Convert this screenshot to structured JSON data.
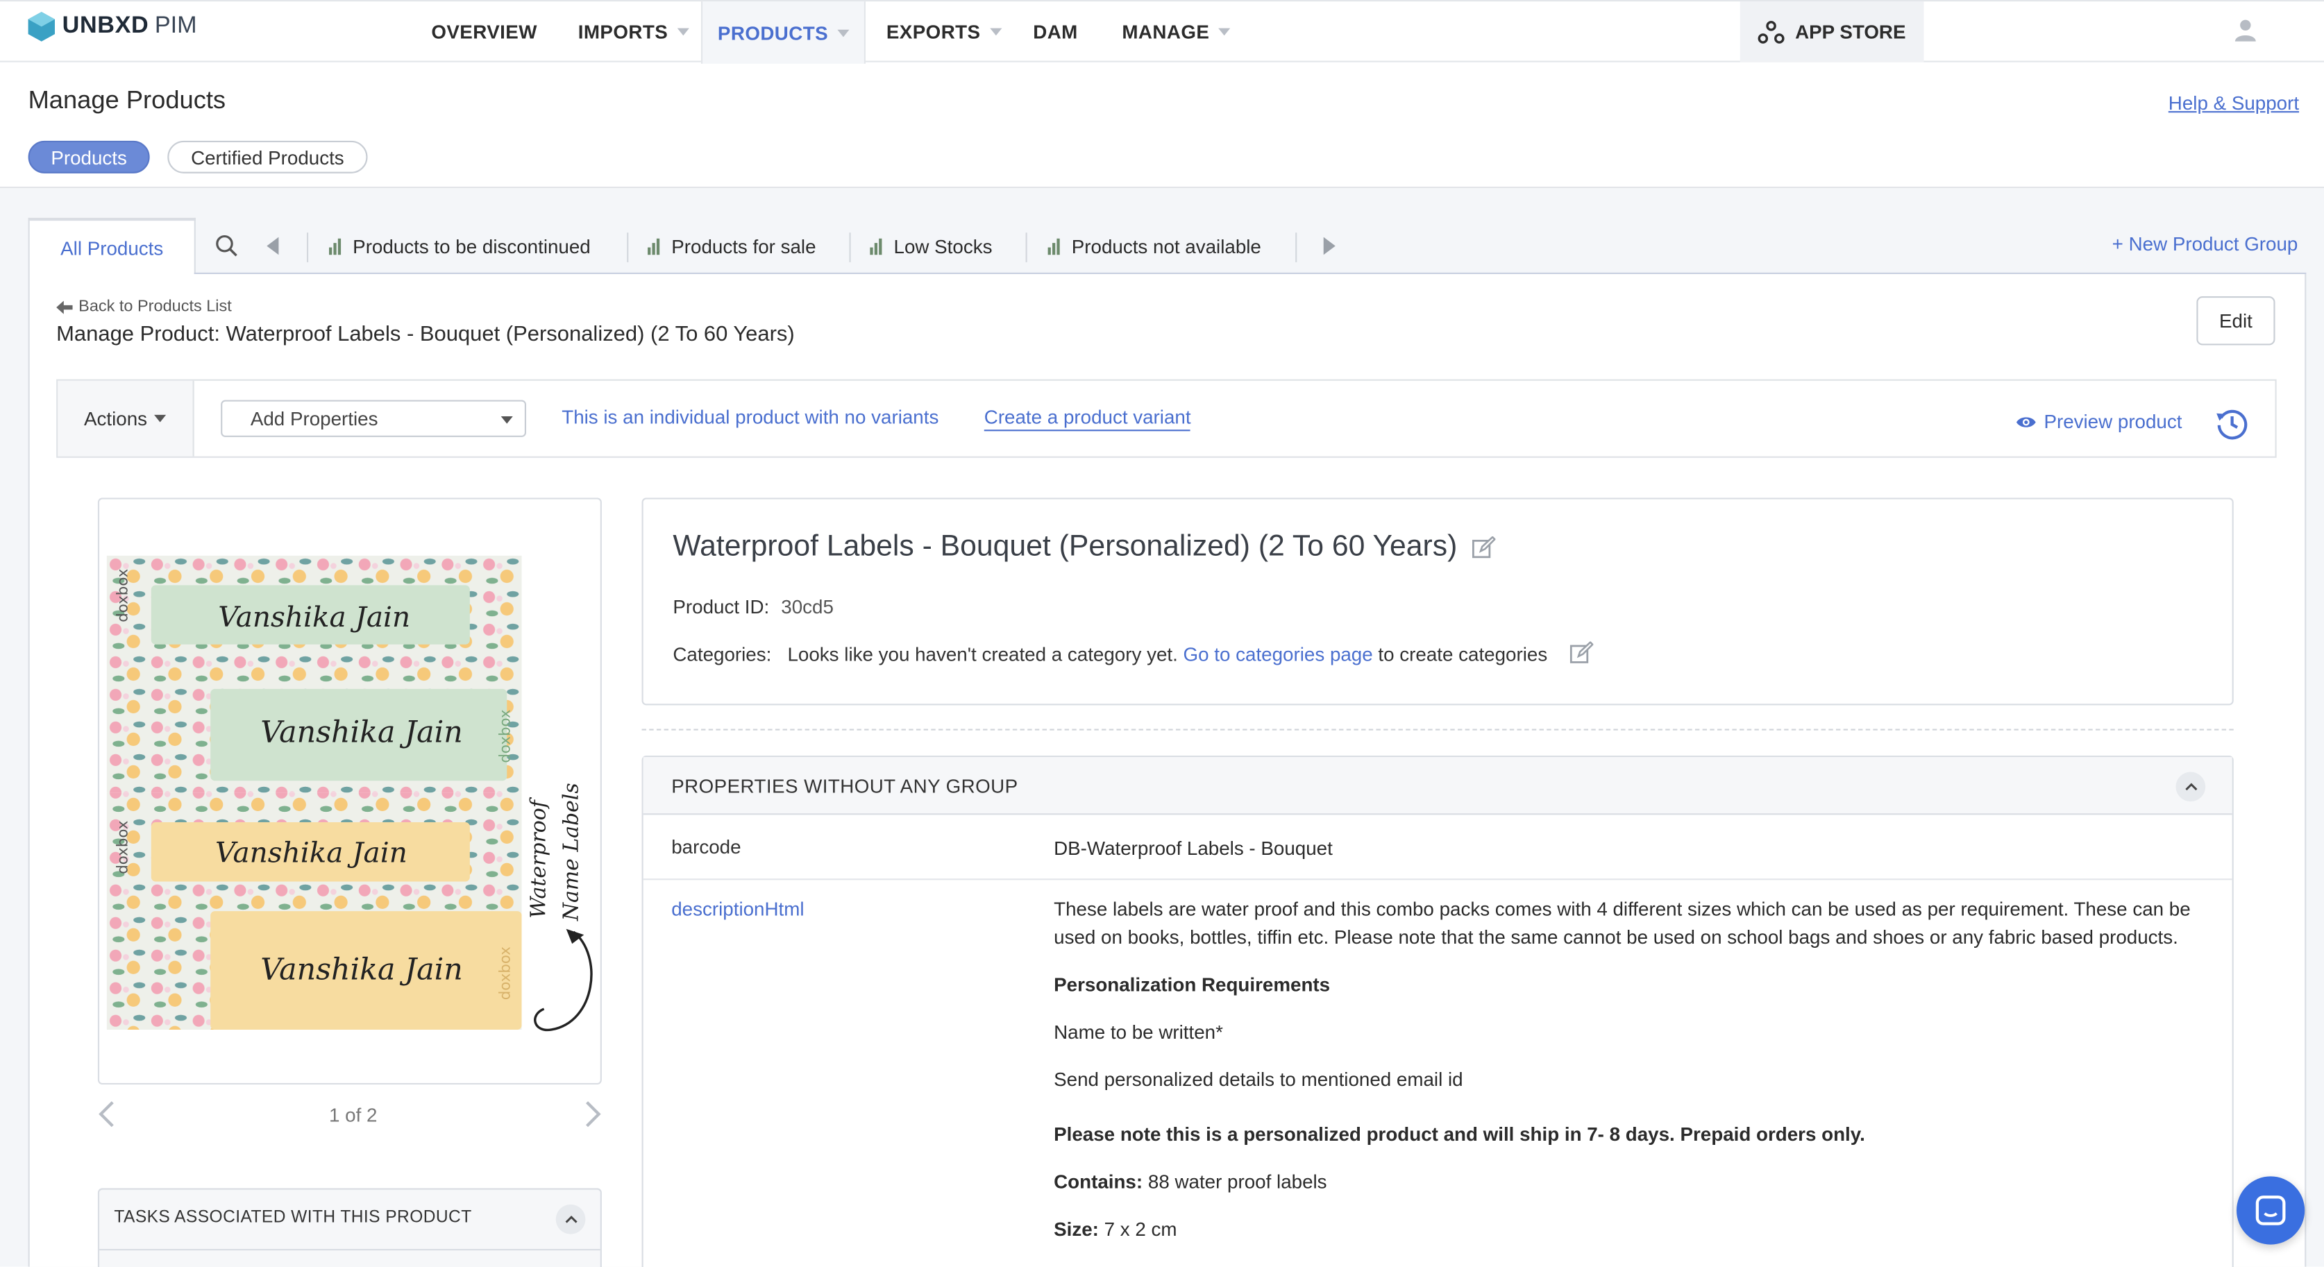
{
  "app": {
    "brand": "UNBXD",
    "product": "PIM"
  },
  "nav": {
    "overview": "OVERVIEW",
    "imports": "IMPORTS",
    "products": "PRODUCTS",
    "exports": "EXPORTS",
    "dam": "DAM",
    "manage": "MANAGE",
    "app_store": "APP STORE"
  },
  "page": {
    "title": "Manage Products",
    "help_link": "Help & Support",
    "pills": {
      "products": "Products",
      "certified": "Certified Products"
    }
  },
  "groups": {
    "all": "All Products",
    "items": [
      "Products to be discontinued",
      "Products for sale",
      "Low Stocks",
      "Products not available"
    ],
    "new_group": "+ New Product Group"
  },
  "detail": {
    "back": "Back to Products List",
    "title": "Manage Product: Waterproof Labels - Bouquet (Personalized) (2 To 60 Years)",
    "edit": "Edit",
    "actions": "Actions",
    "add_properties": "Add Properties",
    "individual_note": "This is an individual product with no variants",
    "create_variant": "Create a product variant",
    "preview": "Preview product"
  },
  "image": {
    "counter": "1 of 2",
    "label_names": [
      "Vanshika Jain",
      "Vanshika Jain",
      "Vanshika Jain",
      "Vanshika Jain"
    ],
    "brand_mark": "doxbox",
    "side_text_1": "Waterproof",
    "side_text_2": "Name Labels"
  },
  "tasks": {
    "title": "TASKS ASSOCIATED WITH THIS PRODUCT"
  },
  "product": {
    "name": "Waterproof Labels - Bouquet (Personalized) (2 To 60 Years)",
    "id_label": "Product ID:",
    "id_value": "30cd5",
    "categories_label": "Categories:",
    "categories_text": "Looks like you haven't created a category yet.",
    "categories_link": "Go to categories page",
    "categories_suffix": "to create categories"
  },
  "properties": {
    "title": "PROPERTIES WITHOUT ANY GROUP",
    "barcode_key": "barcode",
    "barcode_val": "DB-Waterproof Labels - Bouquet",
    "desc_key": "descriptionHtml",
    "desc_p1": "These labels are water proof and this combo packs comes with 4 different sizes which can be used as per requirement. These can be used on books, bottles, tiffin etc. Please note that the same cannot be used on school bags and shoes or any fabric based products.",
    "desc_h": "Personalization Requirements",
    "desc_p2": "Name to be written*",
    "desc_p3": "Send personalized details to mentioned email id",
    "desc_note": "Please note this is a personalized product and will ship in 7- 8 days. Prepaid orders only.",
    "contains_label": "Contains:",
    "contains_val": "88 water proof labels",
    "size_label": "Size:",
    "size_val": "7 x 2 cm"
  },
  "colors": {
    "accent": "#4a6fcf",
    "pill_active": "#6b8ad7",
    "chat": "#3a6fe0"
  }
}
